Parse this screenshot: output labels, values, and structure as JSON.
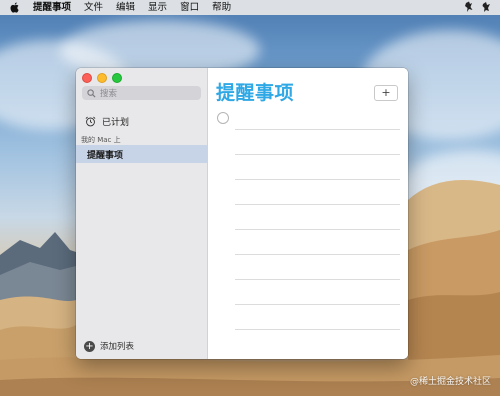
{
  "menubar": {
    "apple_icon": "apple-logo-icon",
    "items": [
      "提醒事项",
      "文件",
      "编辑",
      "显示",
      "窗口",
      "帮助"
    ]
  },
  "sidebar": {
    "search": {
      "placeholder": "搜索",
      "icon": "search-icon"
    },
    "scheduled": {
      "label": "已计划",
      "icon": "alarm-clock-icon"
    },
    "section_label": "我的 Mac 上",
    "lists": [
      {
        "label": "提醒事项",
        "selected": true
      }
    ],
    "add_list_label": "添加列表"
  },
  "main": {
    "title": "提醒事项",
    "add_button_label": "+",
    "empty_rows": 9
  },
  "watermark": "@稀土掘金技术社区",
  "colors": {
    "title_blue": "#2fa8e6",
    "selection": "#c7d3e6",
    "sidebar_bg": "#e8e8ea"
  }
}
